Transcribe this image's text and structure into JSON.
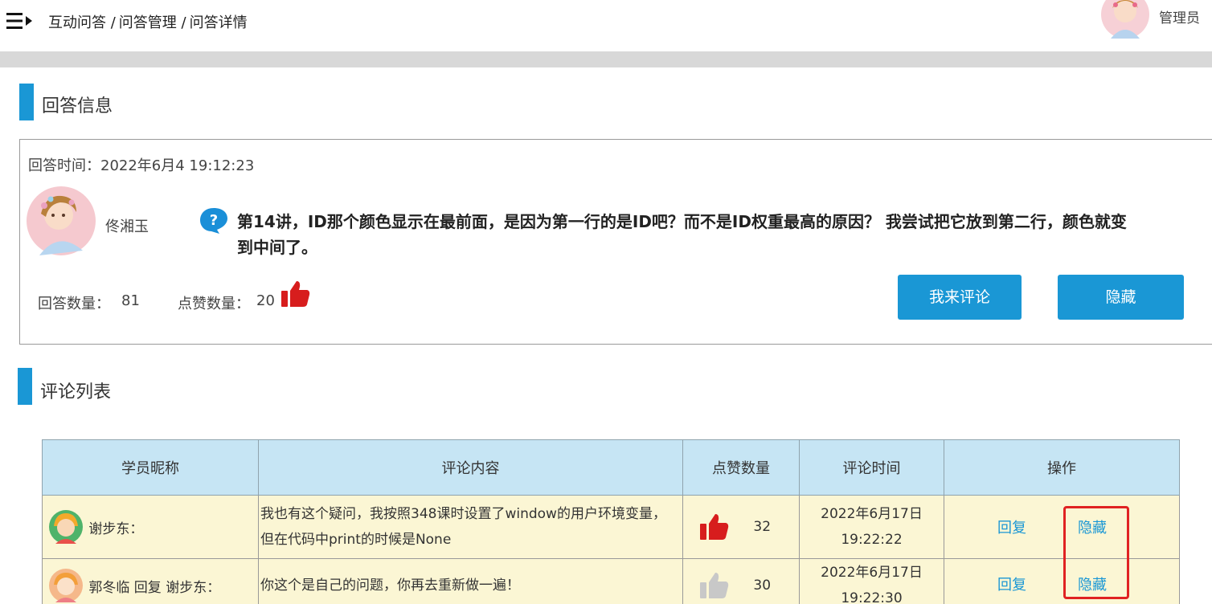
{
  "header": {
    "breadcrumb": [
      "互动问答 /",
      "问答管理 /",
      "问答详情"
    ],
    "admin_name": "管理员"
  },
  "sections": {
    "answer_info_title": "回答信息",
    "comment_list_title": "评论列表"
  },
  "answer": {
    "time_label": "回答时间：",
    "time_value": "2022年6月4 19:12:23",
    "author": "佟湘玉",
    "question": "第14讲，ID那个颜色显示在最前面，是因为第一行的是ID吧？而不是ID权重最高的原因？ 我尝试把它放到第二行，颜色就变到中间了。",
    "answer_count_label": "回答数量：",
    "answer_count": "81",
    "like_count_label": "点赞数量：",
    "like_count": "20",
    "comment_button": "我来评论",
    "hide_button": "隐藏"
  },
  "table": {
    "headers": [
      "学员昵称",
      "评论内容",
      "点赞数量",
      "评论时间",
      "操作"
    ],
    "rows": [
      {
        "user": "谢步东：",
        "content": "我也有这个疑问，我按照348课时设置了window的用户环境变量，但在代码中print的时候是None",
        "likes": "32",
        "liked": true,
        "time_date": "2022年6月17日",
        "time_clock": "19:22:22",
        "reply": "回复",
        "hide": "隐藏"
      },
      {
        "user": "郭冬临 回复 谢步东：",
        "content": "你这个是自己的问题，你再去重新做一遍！",
        "likes": "30",
        "liked": false,
        "time_date": "2022年6月17日",
        "time_clock": "19:22:30",
        "reply": "回复",
        "hide": "隐藏"
      }
    ]
  },
  "colors": {
    "accent": "#1a97d5",
    "like_active": "#d71d1d",
    "like_inactive": "#c8c8c8",
    "table_header": "#c6e5f4",
    "table_row": "#fbf6d4",
    "highlight_frame": "#e02222"
  }
}
